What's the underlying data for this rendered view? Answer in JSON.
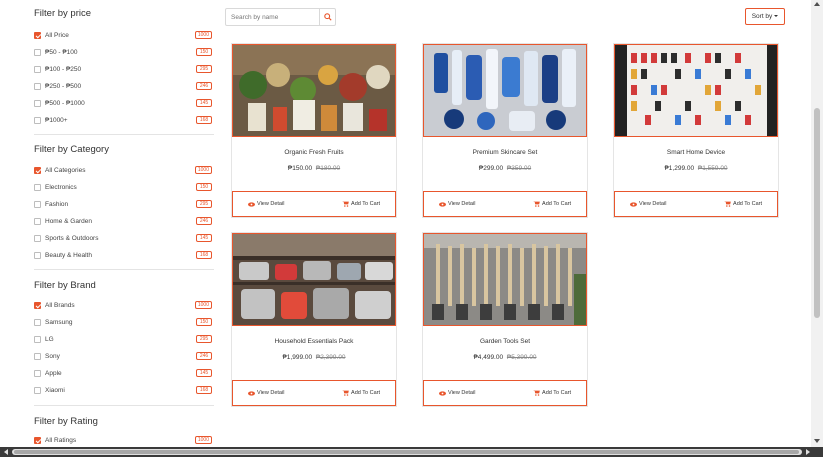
{
  "filters": {
    "price": {
      "title": "Filter by price",
      "options": [
        {
          "label": "All Price",
          "count": "1000",
          "checked": true
        },
        {
          "label": "₱50 - ₱100",
          "count": "150",
          "checked": false
        },
        {
          "label": "₱100 - ₱250",
          "count": "295",
          "checked": false
        },
        {
          "label": "₱250 - ₱500",
          "count": "246",
          "checked": false
        },
        {
          "label": "₱500 - ₱1000",
          "count": "145",
          "checked": false
        },
        {
          "label": "₱1000+",
          "count": "168",
          "checked": false
        }
      ]
    },
    "category": {
      "title": "Filter by Category",
      "options": [
        {
          "label": "All Categories",
          "count": "1000",
          "checked": true
        },
        {
          "label": "Electronics",
          "count": "150",
          "checked": false
        },
        {
          "label": "Fashion",
          "count": "295",
          "checked": false
        },
        {
          "label": "Home & Garden",
          "count": "246",
          "checked": false
        },
        {
          "label": "Sports & Outdoors",
          "count": "145",
          "checked": false
        },
        {
          "label": "Beauty & Health",
          "count": "168",
          "checked": false
        }
      ]
    },
    "brand": {
      "title": "Filter by Brand",
      "options": [
        {
          "label": "All Brands",
          "count": "1000",
          "checked": true
        },
        {
          "label": "Samsung",
          "count": "150",
          "checked": false
        },
        {
          "label": "LG",
          "count": "295",
          "checked": false
        },
        {
          "label": "Sony",
          "count": "246",
          "checked": false
        },
        {
          "label": "Apple",
          "count": "145",
          "checked": false
        },
        {
          "label": "Xiaomi",
          "count": "168",
          "checked": false
        }
      ]
    },
    "rating": {
      "title": "Filter by Rating",
      "options": [
        {
          "label": "All Ratings",
          "count": "1000",
          "checked": true
        }
      ]
    }
  },
  "search": {
    "placeholder": "Search by name"
  },
  "sort": {
    "label": "Sort by"
  },
  "products": [
    {
      "name": "Organic Fresh Fruits",
      "price": "₱150.00",
      "old_price": "₱180.00",
      "view_label": "View Detail",
      "cart_label": "Add To Cart"
    },
    {
      "name": "Premium Skincare Set",
      "price": "₱299.00",
      "old_price": "₱359.00",
      "view_label": "View Detail",
      "cart_label": "Add To Cart"
    },
    {
      "name": "Smart Home Device",
      "price": "₱1,299.00",
      "old_price": "₱1,559.00",
      "view_label": "View Detail",
      "cart_label": "Add To Cart"
    },
    {
      "name": "Household Essentials Pack",
      "price": "₱1,999.00",
      "old_price": "₱2,399.00",
      "view_label": "View Detail",
      "cart_label": "Add To Cart"
    },
    {
      "name": "Garden Tools Set",
      "price": "₱4,499.00",
      "old_price": "₱5,399.00",
      "view_label": "View Detail",
      "cart_label": "Add To Cart"
    }
  ],
  "colors": {
    "accent": "#e8562d"
  }
}
